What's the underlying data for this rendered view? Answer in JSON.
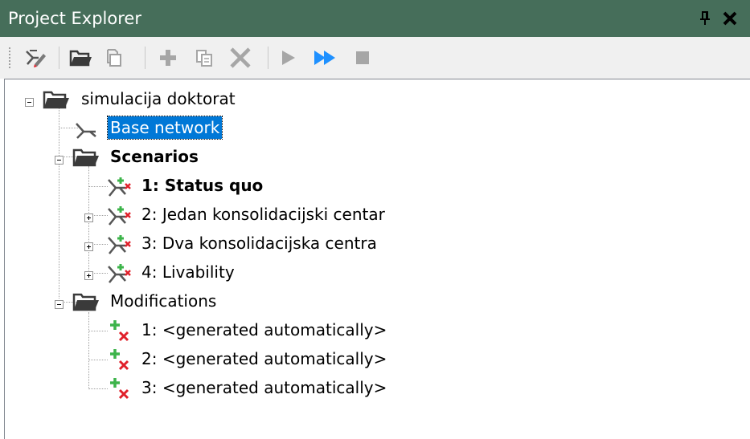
{
  "panel": {
    "title": "Project Explorer"
  },
  "toolbar": {
    "buttons": [
      {
        "icon": "network-edit-icon"
      },
      {
        "icon": "open-folder-icon"
      },
      {
        "icon": "copy-project-icon"
      },
      {
        "icon": "add-icon"
      },
      {
        "icon": "duplicate-icon"
      },
      {
        "icon": "delete-icon"
      },
      {
        "icon": "run-icon"
      },
      {
        "icon": "run-all-icon"
      },
      {
        "icon": "stop-icon"
      }
    ]
  },
  "tree": {
    "root": {
      "label": "simulacija doktorat",
      "expanded": true
    },
    "base_network": {
      "label": "Base network",
      "selected": true
    },
    "scenarios": {
      "label": "Scenarios",
      "expanded": true,
      "items": [
        {
          "label": "1: Status quo",
          "bold": true,
          "has_children": false
        },
        {
          "label": "2: Jedan konsolidacijski centar",
          "has_children": true
        },
        {
          "label": "3: Dva konsolidacijska centra",
          "has_children": true
        },
        {
          "label": "4: Livability",
          "has_children": true
        }
      ]
    },
    "modifications": {
      "label": "Modifications",
      "expanded": true,
      "items": [
        {
          "label": "1: <generated automatically>"
        },
        {
          "label": "2: <generated automatically>"
        },
        {
          "label": "3: <generated automatically>"
        }
      ]
    }
  },
  "colors": {
    "title_bar": "#466e5a",
    "selection": "#0078d7",
    "add_green": "#3cb44a",
    "delete_red": "#e0202a",
    "run_blue": "#1e90ff"
  }
}
